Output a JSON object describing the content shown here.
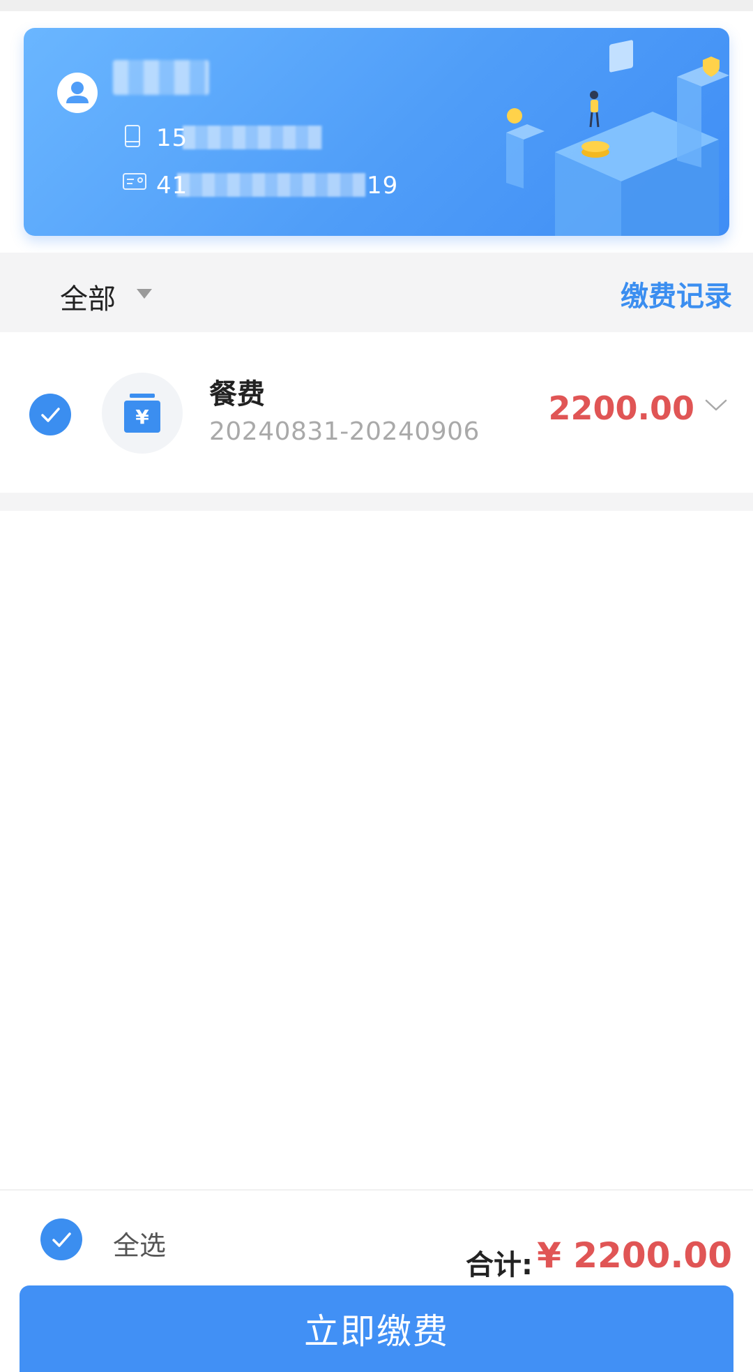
{
  "profile": {
    "phone": "15",
    "id_number_prefix": "41",
    "id_number_suffix": "19"
  },
  "filter": {
    "label": "全部",
    "records_link": "缴费记录"
  },
  "bill": {
    "name": "餐费",
    "period": "20240831-20240906",
    "amount": "2200.00",
    "selected": true
  },
  "footer": {
    "select_all": "全选",
    "total_label": "合计:",
    "total_amount": "¥ 2200.00",
    "pay_button": "立即缴费"
  },
  "colors": {
    "accent": "#3b8ef0",
    "amount": "#e05555",
    "card_start": "#6ab6ff",
    "card_end": "#3f8df5"
  },
  "icons": {
    "avatar": "user-icon",
    "phone": "phone-icon",
    "id_card": "id-card-icon",
    "fee": "yuan-bill-icon",
    "check": "check-icon",
    "expand": "chevron-down-icon",
    "filter": "caret-down-icon"
  }
}
